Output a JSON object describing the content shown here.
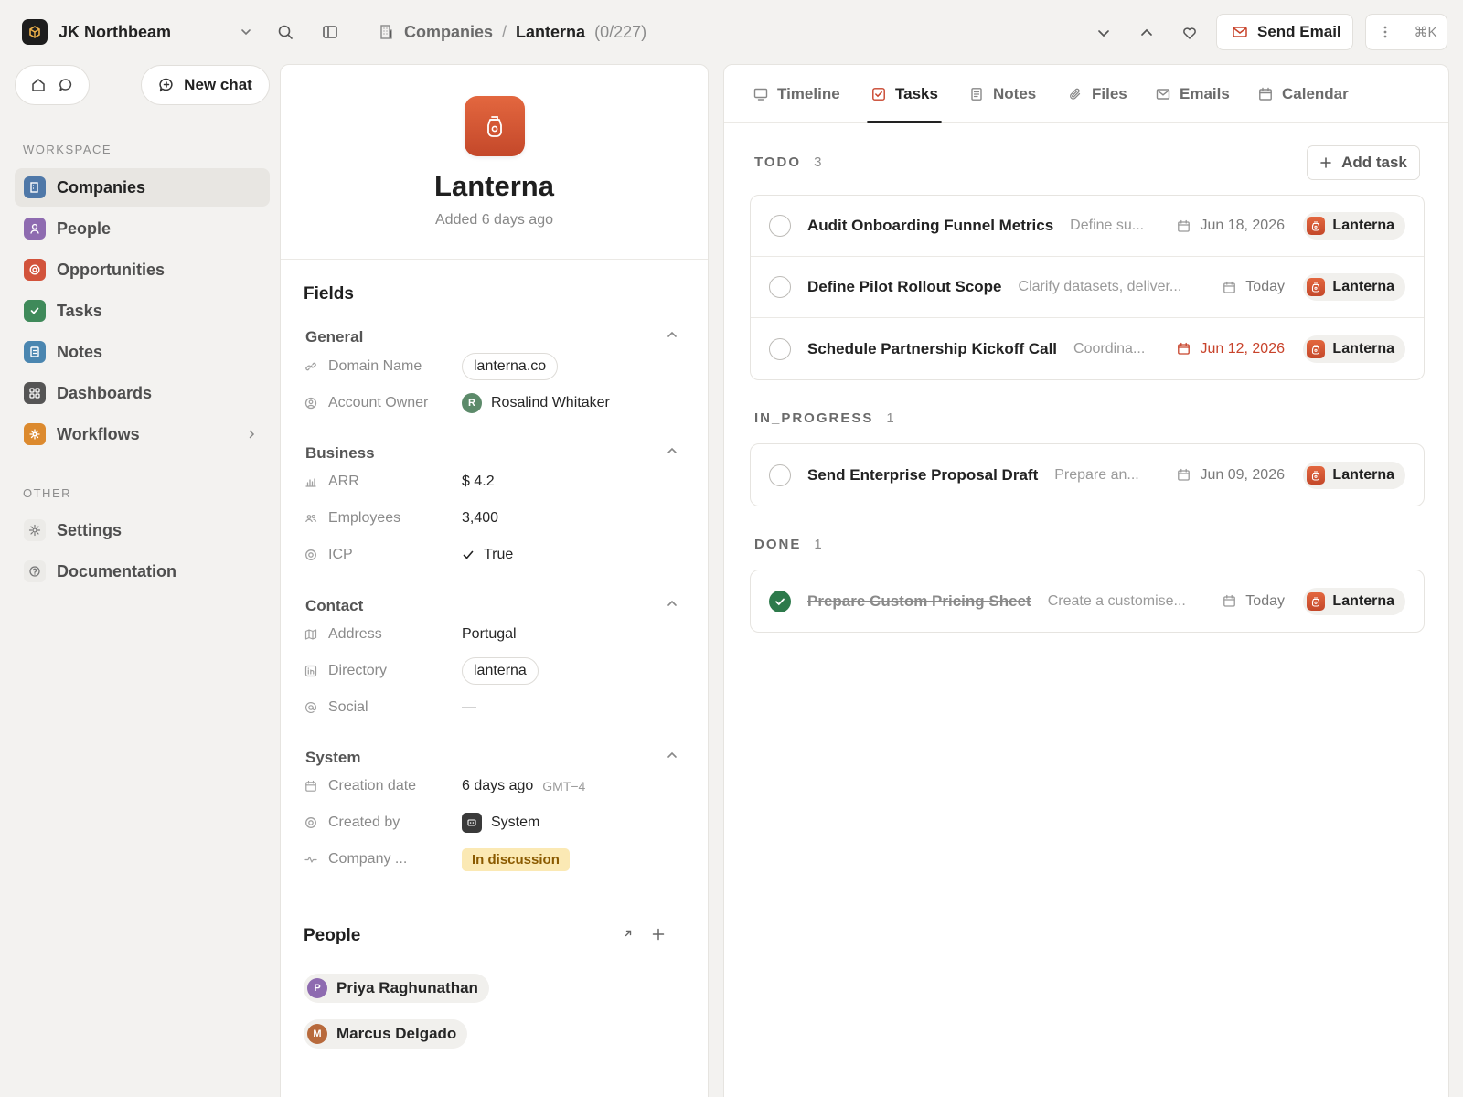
{
  "topbar": {
    "workspace_name": "JK Northbeam",
    "breadcrumb_parent": "Companies",
    "breadcrumb_sep": "/",
    "breadcrumb_current": "Lanterna",
    "breadcrumb_count": "(0/227)",
    "send_email_label": "Send Email",
    "shortcut_label": "⌘K"
  },
  "sidebar": {
    "new_chat_label": "New chat",
    "workspace_label": "WORKSPACE",
    "other_label": "OTHER",
    "items": [
      {
        "label": "Companies",
        "icon": "building-icon",
        "color": "#4f78a8"
      },
      {
        "label": "People",
        "icon": "person-icon",
        "color": "#8e6bb0"
      },
      {
        "label": "Opportunities",
        "icon": "target-icon",
        "color": "#d2533b"
      },
      {
        "label": "Tasks",
        "icon": "checkbox-icon",
        "color": "#3f8a5a"
      },
      {
        "label": "Notes",
        "icon": "note-icon",
        "color": "#4a86b0"
      },
      {
        "label": "Dashboards",
        "icon": "grid-icon",
        "color": "#555555"
      },
      {
        "label": "Workflows",
        "icon": "sparkle-icon",
        "color": "#dc8a2e"
      }
    ],
    "other_items": [
      {
        "label": "Settings",
        "icon": "gear-icon"
      },
      {
        "label": "Documentation",
        "icon": "help-icon"
      }
    ]
  },
  "record": {
    "name": "Lanterna",
    "added": "Added 6 days ago",
    "fields_title": "Fields",
    "groups": {
      "general": "General",
      "business": "Business",
      "contact": "Contact",
      "system": "System"
    },
    "fields": {
      "domain_label": "Domain Name",
      "domain_value": "lanterna.co",
      "owner_label": "Account Owner",
      "owner_initial": "R",
      "owner_value": "Rosalind Whitaker",
      "arr_label": "ARR",
      "arr_value": "$ 4.2",
      "employees_label": "Employees",
      "employees_value": "3,400",
      "icp_label": "ICP",
      "icp_value": "True",
      "address_label": "Address",
      "address_value": "Portugal",
      "directory_label": "Directory",
      "directory_value": "lanterna",
      "social_label": "Social",
      "social_value": "—",
      "creation_label": "Creation date",
      "creation_value": "6 days ago",
      "creation_tz": "GMT−4",
      "createdby_label": "Created by",
      "createdby_value": "System",
      "companystage_label": "Company ...",
      "companystage_value": "In discussion"
    },
    "people_title": "People",
    "people": [
      {
        "initial": "P",
        "name": "Priya Raghunathan",
        "color": "#8e6bb0"
      },
      {
        "initial": "M",
        "name": "Marcus Delgado",
        "color": "#b86a3c"
      }
    ]
  },
  "tabs": [
    {
      "label": "Timeline",
      "icon": "monitor-icon"
    },
    {
      "label": "Tasks",
      "icon": "checkbox-icon"
    },
    {
      "label": "Notes",
      "icon": "note-icon"
    },
    {
      "label": "Files",
      "icon": "paperclip-icon"
    },
    {
      "label": "Emails",
      "icon": "mail-icon"
    },
    {
      "label": "Calendar",
      "icon": "calendar-icon"
    }
  ],
  "active_tab": "Tasks",
  "tasks": {
    "add_task_label": "Add task",
    "sections": [
      {
        "title": "TODO",
        "count": "3",
        "items": [
          {
            "title": "Audit Onboarding Funnel Metrics",
            "desc": "Define su...",
            "date": "Jun 18, 2026",
            "overdue": false,
            "company": "Lanterna",
            "done": false
          },
          {
            "title": "Define Pilot Rollout Scope",
            "desc": "Clarify datasets, deliver...",
            "date": "Today",
            "overdue": false,
            "company": "Lanterna",
            "done": false
          },
          {
            "title": "Schedule Partnership Kickoff Call",
            "desc": "Coordina...",
            "date": "Jun 12, 2026",
            "overdue": true,
            "company": "Lanterna",
            "done": false
          }
        ]
      },
      {
        "title": "IN_PROGRESS",
        "count": "1",
        "items": [
          {
            "title": "Send Enterprise Proposal Draft",
            "desc": "Prepare an...",
            "date": "Jun 09, 2026",
            "overdue": false,
            "company": "Lanterna",
            "done": false
          }
        ]
      },
      {
        "title": "DONE",
        "count": "1",
        "items": [
          {
            "title": "Prepare Custom Pricing Sheet",
            "desc": "Create a customise...",
            "date": "Today",
            "overdue": false,
            "company": "Lanterna",
            "done": true
          }
        ]
      }
    ]
  }
}
